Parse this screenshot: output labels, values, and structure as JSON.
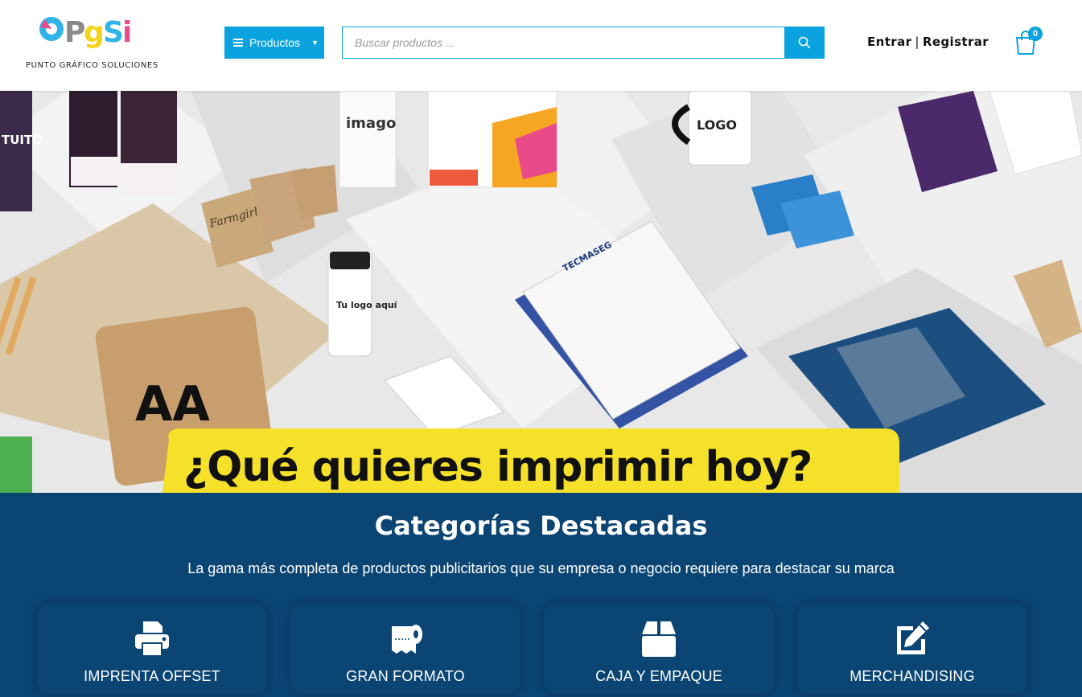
{
  "header": {
    "logo_text": "PGSI",
    "logo_subtitle": "PUNTO GRÁFICO SOLUCIONES",
    "products_button": "Productos",
    "search_placeholder": "Buscar productos ...",
    "login_link": "Entrar",
    "separator": "|",
    "register_link": "Registrar",
    "cart_count": "0"
  },
  "hero": {
    "headline": "¿Qué quieres imprimir hoy?",
    "product_texts": {
      "banner_text": "TUITO",
      "brochure_brand": "imago",
      "mug_text": "LOGO",
      "tag_brand": "Farmgirl",
      "bottle_text": "Tu logo aquí",
      "invoice_brand": "TECMASEG"
    }
  },
  "categories": {
    "title": "Categorías Destacadas",
    "subtitle": "La gama más completa de productos publicitarios que su empresa o negocio requiere para destacar su marca",
    "items": [
      {
        "label": "IMPRENTA OFFSET",
        "icon": "printer-icon"
      },
      {
        "label": "GRAN FORMATO",
        "icon": "paper-roll-icon"
      },
      {
        "label": "CAJA Y EMPAQUE",
        "icon": "box-icon"
      },
      {
        "label": "MERCHANDISING",
        "icon": "edit-icon"
      }
    ]
  },
  "colors": {
    "accent": "#0aa3e0",
    "section_bg": "#0b4574",
    "hero_banner": "#f5e02a"
  }
}
